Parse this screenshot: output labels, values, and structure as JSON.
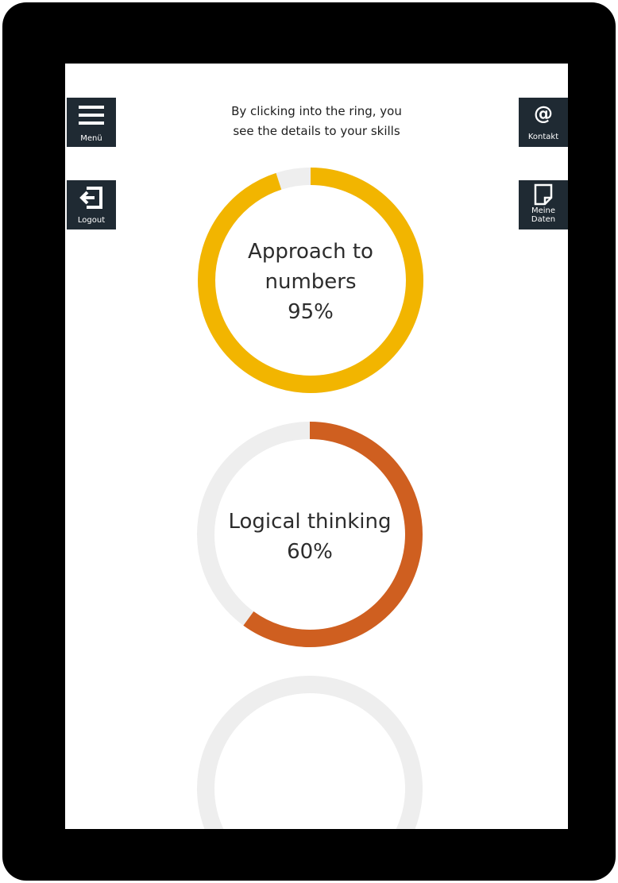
{
  "intro_text": {
    "line1": "By clicking into the ring, you",
    "line2": "see the details to your skills"
  },
  "nav": {
    "menu": {
      "label": "Menü",
      "icon": "hamburger-icon"
    },
    "logout": {
      "label": "Logout",
      "icon": "logout-icon"
    },
    "contact": {
      "label": "Kontakt",
      "icon": "at-icon"
    },
    "my_data": {
      "label_line1": "Meine",
      "label_line2": "Daten",
      "icon": "document-icon"
    }
  },
  "skills": [
    {
      "name_line1": "Approach to",
      "name_line2": "numbers",
      "percent_text": "95%",
      "percent": 95,
      "color": "#f2b500"
    },
    {
      "name_line1": "Logical thinking",
      "name_line2": "",
      "percent_text": "60%",
      "percent": 60,
      "color": "#cf5f20"
    },
    {
      "name_line1": "",
      "name_line2": "",
      "percent_text": "",
      "percent": 0,
      "color": "#cccccc"
    }
  ],
  "colors": {
    "track": "#eeeeee",
    "nav_button_bg": "#1f2a33",
    "bezel": "#000000"
  }
}
